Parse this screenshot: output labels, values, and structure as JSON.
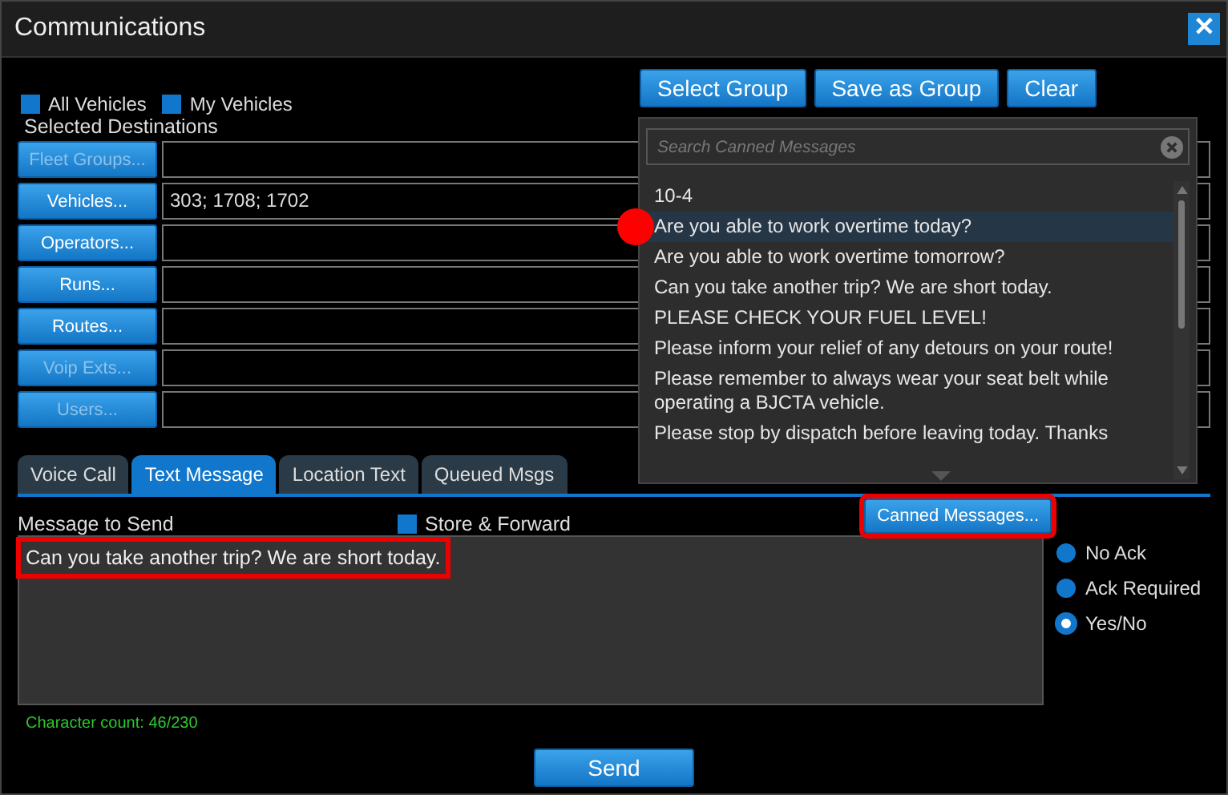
{
  "window": {
    "title": "Communications",
    "close": "✕"
  },
  "filters": [
    {
      "label": "All Vehicles",
      "checked": true
    },
    {
      "label": "My Vehicles",
      "checked": true
    }
  ],
  "destinations_label": "Selected Destinations",
  "destinations": [
    {
      "button": "Fleet Groups...",
      "disabled": true
    },
    {
      "button": "Vehicles...",
      "disabled": false,
      "value": "303; 1708; 1702"
    },
    {
      "button": "Operators...",
      "disabled": false
    },
    {
      "button": "Runs...",
      "disabled": false
    },
    {
      "button": "Routes...",
      "disabled": false
    },
    {
      "button": "Voip Exts...",
      "disabled": true
    },
    {
      "button": "Users...",
      "disabled": true
    }
  ],
  "group_buttons": [
    "Select Group",
    "Save as Group",
    "Clear"
  ],
  "canned_popup": {
    "search": {
      "placeholder": "Search Canned Messages"
    },
    "items": [
      {
        "text": "10-4",
        "selected": false,
        "marked": false
      },
      {
        "text": "Are you able to work overtime today?",
        "selected": true,
        "marked": true
      },
      {
        "text": "Are you able to work overtime tomorrow?",
        "selected": false,
        "marked": false
      },
      {
        "text": "Can you take another trip? We are short today.",
        "selected": false,
        "marked": false
      },
      {
        "text": "PLEASE CHECK YOUR FUEL LEVEL!",
        "selected": false,
        "marked": false
      },
      {
        "text": "Please inform your relief of any detours on your route!",
        "selected": false,
        "marked": false
      },
      {
        "text": "Please remember to always wear your seat belt while operating a BJCTA vehicle.",
        "selected": false,
        "marked": false
      },
      {
        "text": "Please stop by dispatch before leaving today. Thanks",
        "selected": false,
        "marked": false
      }
    ]
  },
  "tabs": [
    {
      "label": "Voice Call",
      "selected": false
    },
    {
      "label": "Text Message",
      "selected": true
    },
    {
      "label": "Location Text",
      "selected": false
    },
    {
      "label": "Queued Msgs",
      "selected": false
    }
  ],
  "message": {
    "label": "Message to Send",
    "store_forward": {
      "label": "Store & Forward",
      "checked": true
    },
    "canned_button": "Canned Messages...",
    "canned_highlighted": true,
    "value": "Can you take another trip? We are short today.",
    "value_highlighted": true,
    "char_count": "Character count: 46/230"
  },
  "ack_options": [
    {
      "label": "No Ack",
      "selected": false
    },
    {
      "label": "Ack Required",
      "selected": false
    },
    {
      "label": "Yes/No",
      "selected": true
    }
  ],
  "send": "Send"
}
